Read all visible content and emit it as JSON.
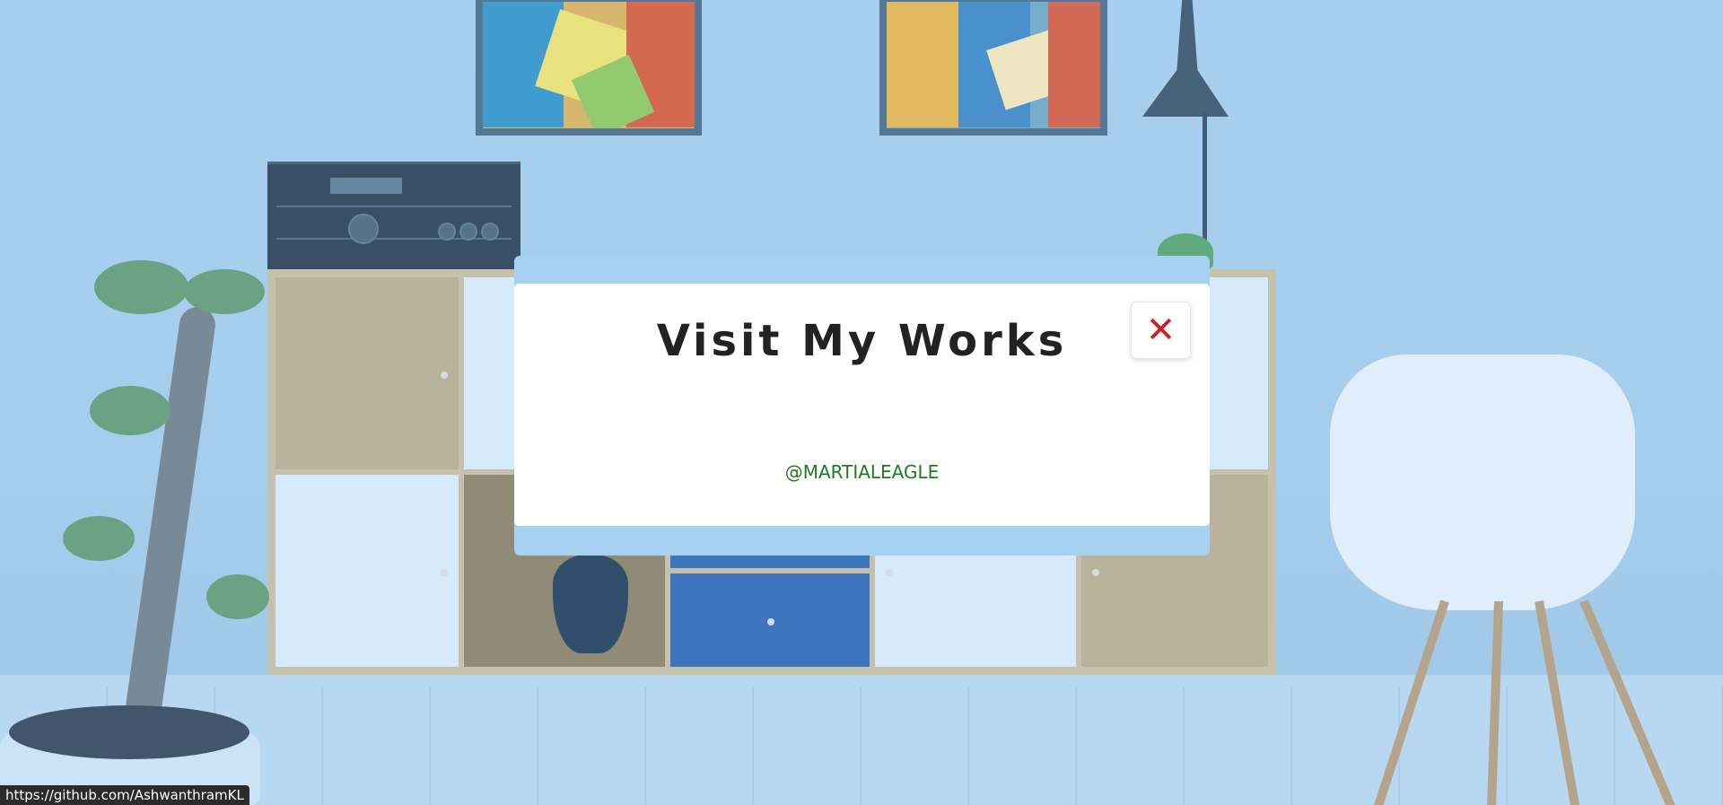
{
  "modal": {
    "title": "Visit My Works",
    "handle": "@MARTIALEAGLE",
    "close_icon": "close-icon"
  },
  "status_bar": {
    "url": "https://github.com/AshwanthramKL"
  },
  "colors": {
    "modal_background": "#ffffff",
    "modal_frame": "#a7d1f1",
    "close_icon": "#c32525",
    "handle_text": "#1f7a1f",
    "title_text": "#222222"
  }
}
